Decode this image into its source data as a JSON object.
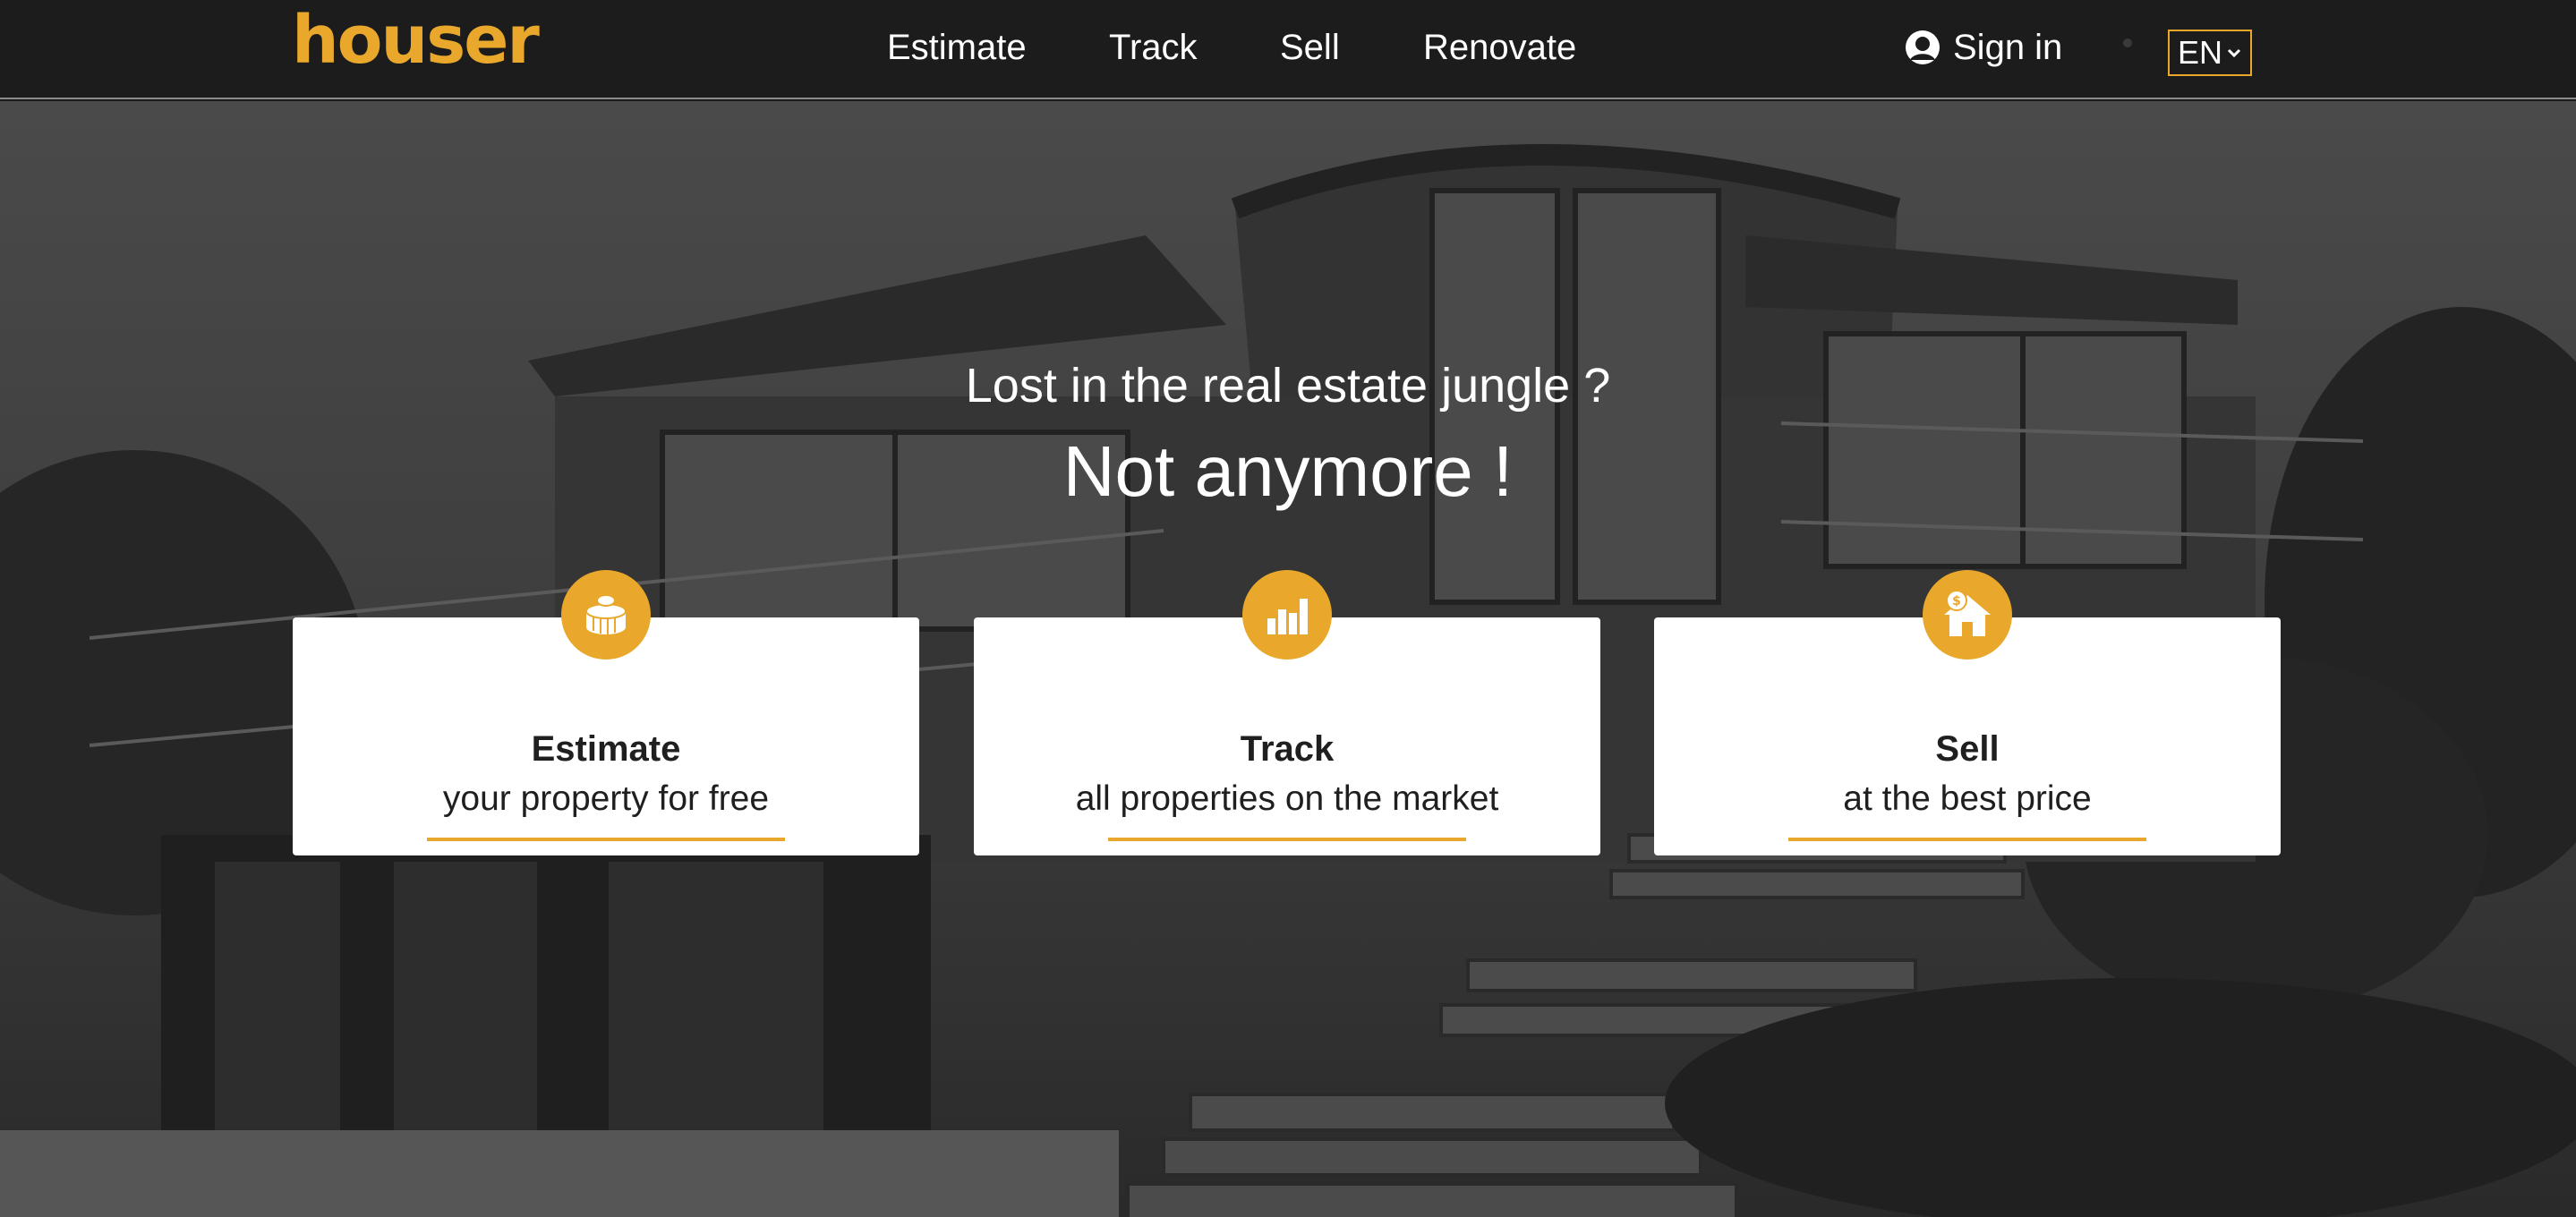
{
  "brand": {
    "logo_text": "houser",
    "accent_color": "#e9a82b"
  },
  "nav": {
    "links": [
      "Estimate",
      "Track",
      "Sell",
      "Renovate"
    ],
    "signin_label": "Sign in",
    "language": "EN"
  },
  "hero": {
    "headline": "Lost in the real estate jungle ?",
    "subheadline": "Not anymore !"
  },
  "cards": [
    {
      "title": "Estimate",
      "subtitle": "your property for free",
      "icon": "coins-icon"
    },
    {
      "title": "Track",
      "subtitle": "all properties on the market",
      "icon": "bar-chart-icon"
    },
    {
      "title": "Sell",
      "subtitle": "at the best price",
      "icon": "house-dollar-icon"
    }
  ]
}
